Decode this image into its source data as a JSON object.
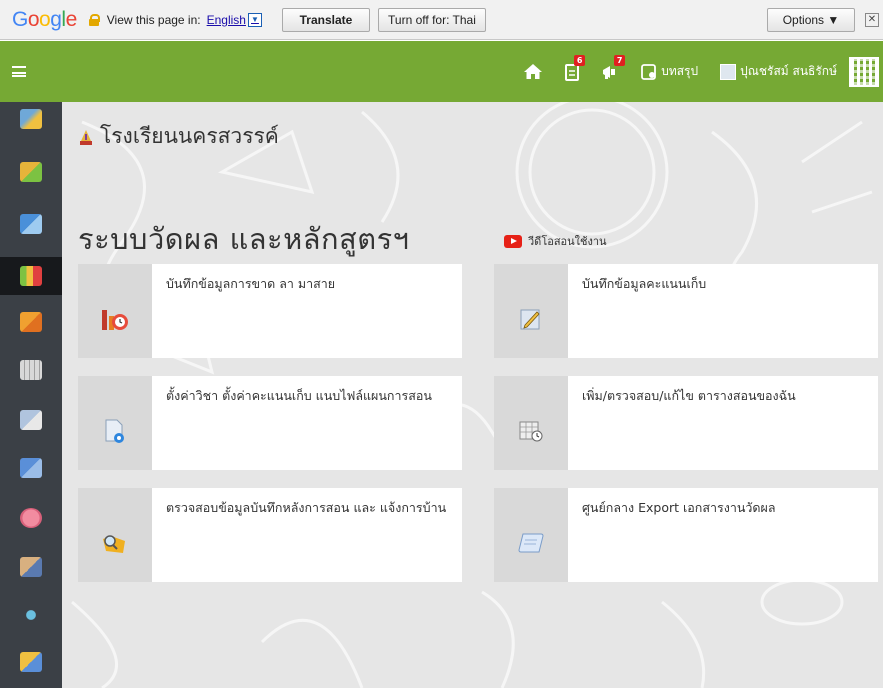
{
  "google_bar": {
    "view_in_text": "View this page in:",
    "language": "English",
    "translate_label": "Translate",
    "turn_off_label": "Turn off for: Thai",
    "options_label": "Options ▼",
    "close_label": "✕"
  },
  "top_bar": {
    "notifications_badge": "6",
    "alerts_badge": "7",
    "summary_label": "บทสรุป",
    "user_name": "ปุณชรัสม์ สนธิรักษ์"
  },
  "sidebar": {
    "items": [
      {
        "icon": "users-group-icon",
        "color": "#6fa8d8"
      },
      {
        "icon": "people-icon",
        "color": "#e6b43a"
      },
      {
        "icon": "book-icon",
        "color": "#4a90d9"
      },
      {
        "icon": "bar-chart-icon",
        "color": "#7cc242",
        "active": true
      },
      {
        "icon": "thumbs-up-icon",
        "color": "#f0a030"
      },
      {
        "icon": "calendar-icon",
        "color": "#c8c8c8"
      },
      {
        "icon": "document-icon",
        "color": "#b0c4de"
      },
      {
        "icon": "cloud-upload-icon",
        "color": "#5a8fd8"
      },
      {
        "icon": "piggy-bank-icon",
        "color": "#f28ca0"
      },
      {
        "icon": "teacher-icon",
        "color": "#d8b080"
      },
      {
        "icon": "network-icon",
        "color": "#6ac0e0"
      },
      {
        "icon": "folder-icon",
        "color": "#f0c040"
      }
    ]
  },
  "main": {
    "school_name": "โรงเรียนนครสวรรค์",
    "page_title": "ระบบวัดผล และหลักสูตรฯ",
    "video_link": "วีดีโอสอนใช้งาน",
    "cards": [
      {
        "label": "บันทึกข้อมูลการขาด ลา มาสาย",
        "icon": "attendance-icon"
      },
      {
        "label": "บันทึกข้อมูลคะแนนเก็บ",
        "icon": "edit-score-icon"
      },
      {
        "label": "ตั้งค่าวิชา ตั้งค่าคะแนนเก็บ แนบไฟล์แผนการสอน",
        "icon": "settings-doc-icon"
      },
      {
        "label": "เพิ่ม/ตรวจสอบ/แก้ไข ตารางสอนของฉัน",
        "icon": "timetable-icon"
      },
      {
        "label": "ตรวจสอบข้อมูลบันทึกหลังการสอน และ แจ้งการบ้าน",
        "icon": "search-folder-icon"
      },
      {
        "label": "ศูนย์กลาง Export เอกสารงานวัดผล",
        "icon": "export-scroll-icon"
      }
    ]
  }
}
